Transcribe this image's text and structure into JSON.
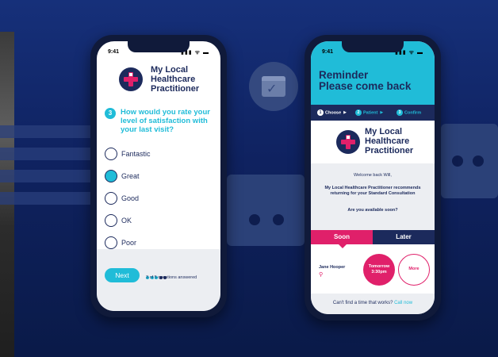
{
  "colors": {
    "navy": "#1c2a5c",
    "cyan": "#20bcd8",
    "magenta": "#e0206a",
    "background": "#0f2260"
  },
  "survey_screen": {
    "status_time": "9:41",
    "status_icons": "▮▮▮ ᯤ ▬",
    "logo_text_line1": "My Local",
    "logo_text_line2": "Healthcare",
    "logo_text_line3": "Practitioner",
    "question_number": "3",
    "question_text": "How would you rate your level of satisfaction with your last visit?",
    "options": [
      {
        "label": "Fantastic",
        "selected": false
      },
      {
        "label": "Great",
        "selected": true
      },
      {
        "label": "Good",
        "selected": false
      },
      {
        "label": "OK",
        "selected": false
      },
      {
        "label": "Poor",
        "selected": false
      }
    ],
    "next_label": "Next",
    "progress_answered": 3,
    "progress_total": 5,
    "progress_text": "3 of 5 questions answered"
  },
  "reminder_screen": {
    "status_time": "9:41",
    "status_icons": "▮▮▮ ᯤ ▬",
    "title_line1": "Reminder",
    "title_line2": "Please come back",
    "steps": [
      {
        "num": "1",
        "label": "Choose"
      },
      {
        "num": "2",
        "label": "Patient"
      },
      {
        "num": "3",
        "label": "Confirm"
      }
    ],
    "logo_text_line1": "My Local",
    "logo_text_line2": "Healthcare",
    "logo_text_line3": "Practitioner",
    "welcome": "Welcome back Will,",
    "recommendation": "My Local Healthcare Practitioner recommends returning for your Standard Consultation",
    "available": "Are you available soon?",
    "tab_soon": "Soon",
    "tab_later": "Later",
    "practitioner": "Jane Hooper",
    "slot_day": "Tomorrow",
    "slot_time": "3:30pm",
    "more_label": "More",
    "cant_find": "Can't find a time that works?",
    "call_now": "Call now"
  }
}
